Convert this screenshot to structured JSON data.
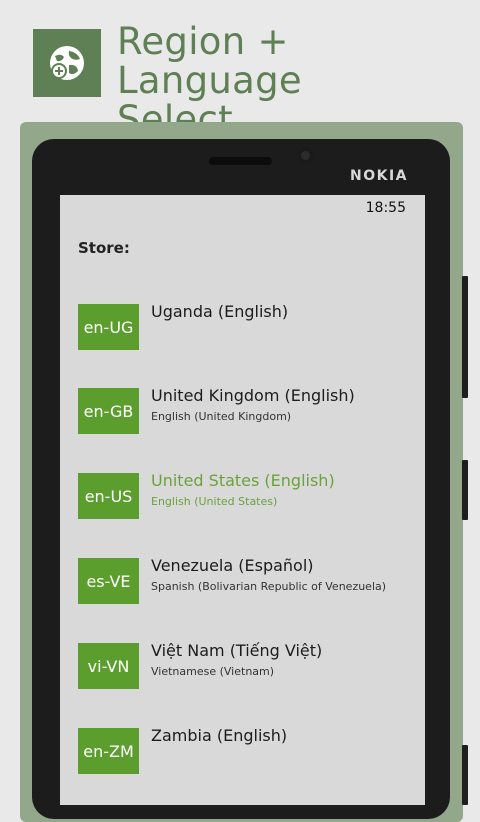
{
  "header": {
    "icon": "globe-add-icon",
    "title_line1": "Region + Language",
    "title_line2": "Select"
  },
  "device": {
    "brand": "NOKIA",
    "time": "18:55"
  },
  "screen": {
    "section_label": "Store:",
    "items": [
      {
        "code": "en-UG",
        "name": "Uganda (English)",
        "sub": ""
      },
      {
        "code": "en-GB",
        "name": "United Kingdom (English)",
        "sub": "English (United Kingdom)"
      },
      {
        "code": "en-US",
        "name": "United States (English)",
        "sub": "English (United States)",
        "selected": true
      },
      {
        "code": "es-VE",
        "name": "Venezuela (Español)",
        "sub": "Spanish (Bolivarian Republic of Venezuela)"
      },
      {
        "code": "vi-VN",
        "name": "Việt Nam (Tiếng Việt)",
        "sub": "Vietnamese (Vietnam)"
      },
      {
        "code": "en-ZM",
        "name": "Zambia (English)",
        "sub": ""
      }
    ]
  },
  "colors": {
    "accent": "#5b9e2e",
    "title": "#5f7f55",
    "selected_text": "#6aa23e"
  }
}
